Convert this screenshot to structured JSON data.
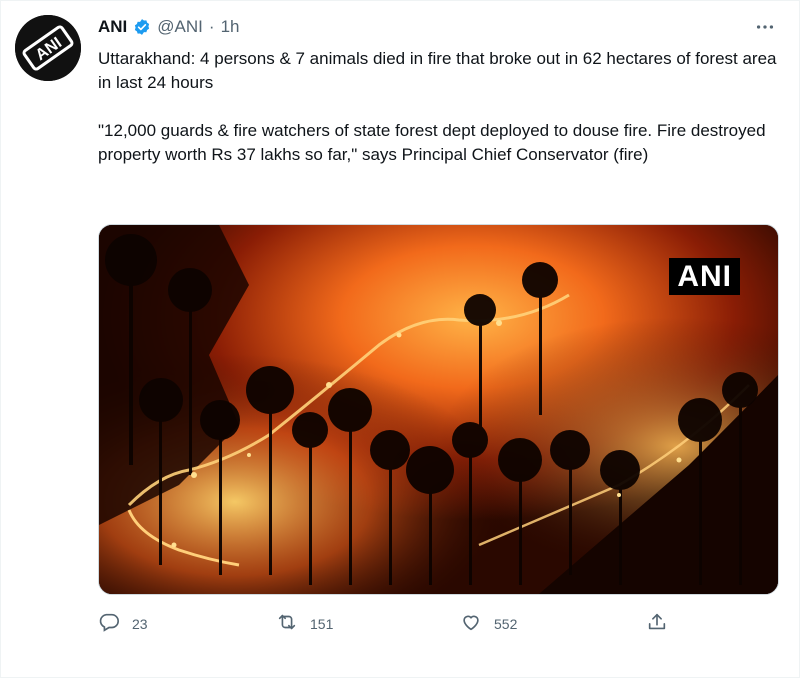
{
  "tweet": {
    "author_name": "ANI",
    "handle": "@ANI",
    "separator": "·",
    "time": "1h",
    "text_paragraph_1": "Uttarakhand: 4 persons & 7 animals died in fire that broke out in 62 hectares of forest area in last 24 hours",
    "text_paragraph_2": "\"12,000 guards & fire watchers of state forest dept deployed to douse fire. Fire destroyed property worth Rs 37 lakhs so far,\" says Principal Chief Conservator (fire)",
    "media": {
      "watermark": "ANI",
      "description_icon": "forest-fire-photo"
    },
    "avatar_logo_text": "ANI",
    "actions": {
      "reply_count": "23",
      "retweet_count": "151",
      "like_count": "552"
    }
  },
  "colors": {
    "text_primary": "#0f1419",
    "text_secondary": "#536471",
    "verified_blue": "#1d9bf0",
    "border": "#cfd9de"
  },
  "icons": [
    "verified-icon",
    "more-icon",
    "reply-icon",
    "retweet-icon",
    "like-icon",
    "share-icon"
  ]
}
